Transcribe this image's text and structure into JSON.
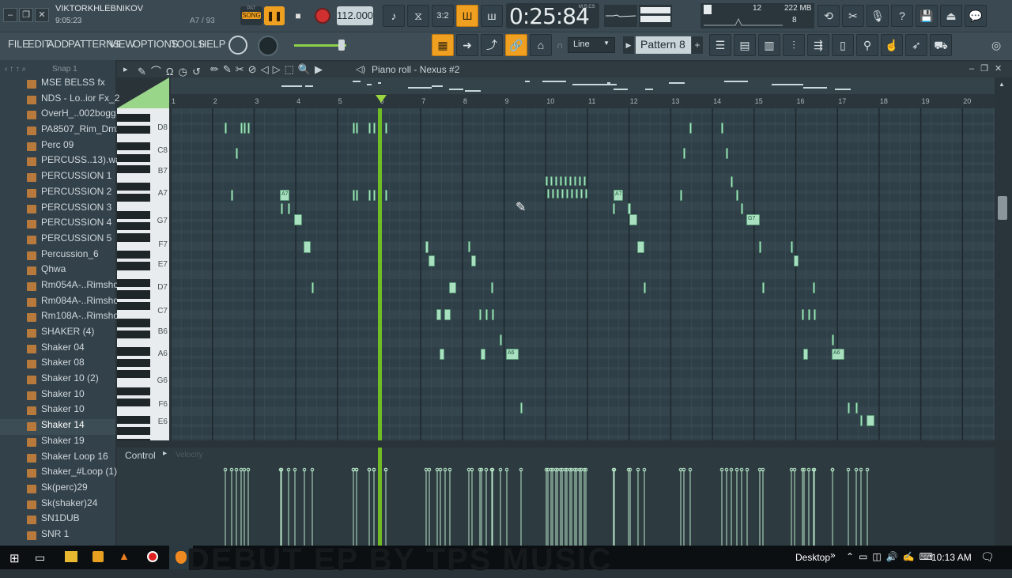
{
  "window": {
    "user": "VIKTORKHLEBNIKOV",
    "time": "9:05:23",
    "hint_position": "A7 / 93"
  },
  "transport": {
    "mode_label": "SONG",
    "mode_pat": "PAT",
    "tempo": "112.000",
    "time_display": "0:25:84",
    "time_unit": "M:S:CS",
    "cpu": "12",
    "memory": "222 MB",
    "polyphony": "8"
  },
  "menu": {
    "file": "FILE",
    "edit": "EDIT",
    "add": "ADD",
    "patterns": "PATTERNS",
    "view": "VIEW",
    "options": "OPTIONS",
    "tools": "TOOLS",
    "help": "HELP"
  },
  "toolbar": {
    "snap_label": "Line",
    "pattern_label": "Pattern 8",
    "add_label": "+"
  },
  "browser": {
    "snap": "Snap 1",
    "items": [
      {
        "label": "MSE BELSS fx"
      },
      {
        "label": "NDS - Lo..ior Fx_2"
      },
      {
        "label": "OverH_..002bogg"
      },
      {
        "label": "PA8507_Rim_Dmx"
      },
      {
        "label": "Perc 09"
      },
      {
        "label": "PERCUSS..13).wav"
      },
      {
        "label": "PERCUSSION 1"
      },
      {
        "label": "PERCUSSION 2"
      },
      {
        "label": "PERCUSSION 3"
      },
      {
        "label": "PERCUSSION 4"
      },
      {
        "label": "PERCUSSION 5"
      },
      {
        "label": "Percussion_6"
      },
      {
        "label": "Qhwa"
      },
      {
        "label": "Rm054A-..Rimshot"
      },
      {
        "label": "Rm084A-..Rimshot"
      },
      {
        "label": "Rm108A-..Rimshot"
      },
      {
        "label": "SHAKER (4)"
      },
      {
        "label": "Shaker 04"
      },
      {
        "label": "Shaker 08"
      },
      {
        "label": "Shaker 10 (2)"
      },
      {
        "label": "Shaker 10"
      },
      {
        "label": "Shaker 10"
      },
      {
        "label": "Shaker 14"
      },
      {
        "label": "Shaker 19"
      },
      {
        "label": "Shaker Loop 16"
      },
      {
        "label": "Shaker_#Loop (1)"
      },
      {
        "label": "Sk(perc)29"
      },
      {
        "label": "Sk(shaker)24"
      },
      {
        "label": "SN1DUB"
      },
      {
        "label": "SNR 1"
      }
    ]
  },
  "piano_roll": {
    "title": "Piano roll - Nexus #2",
    "control_label": "Control",
    "control_param": "Velocity",
    "bars": [
      "1",
      "2",
      "3",
      "4",
      "5",
      "6",
      "7",
      "8",
      "9",
      "10",
      "11",
      "12",
      "13",
      "14",
      "15",
      "16",
      "17",
      "18",
      "19",
      "20"
    ],
    "keys": [
      "D8",
      "C8",
      "B7",
      "A7",
      "G7",
      "F7",
      "E7",
      "D7",
      "C7",
      "B6",
      "A6",
      "G6",
      "F6",
      "E6"
    ],
    "note_labels": {
      "a7": "A7",
      "g7": "G7",
      "a6": "A6"
    }
  },
  "taskbar": {
    "desktop": "Desktop",
    "clock": "10:13 AM",
    "overlay_text": "DEBUT EP BY TPS MUSIC"
  },
  "colors": {
    "accent": "#f0a020",
    "note": "#a8e0c0",
    "playhead": "#7ed321"
  }
}
